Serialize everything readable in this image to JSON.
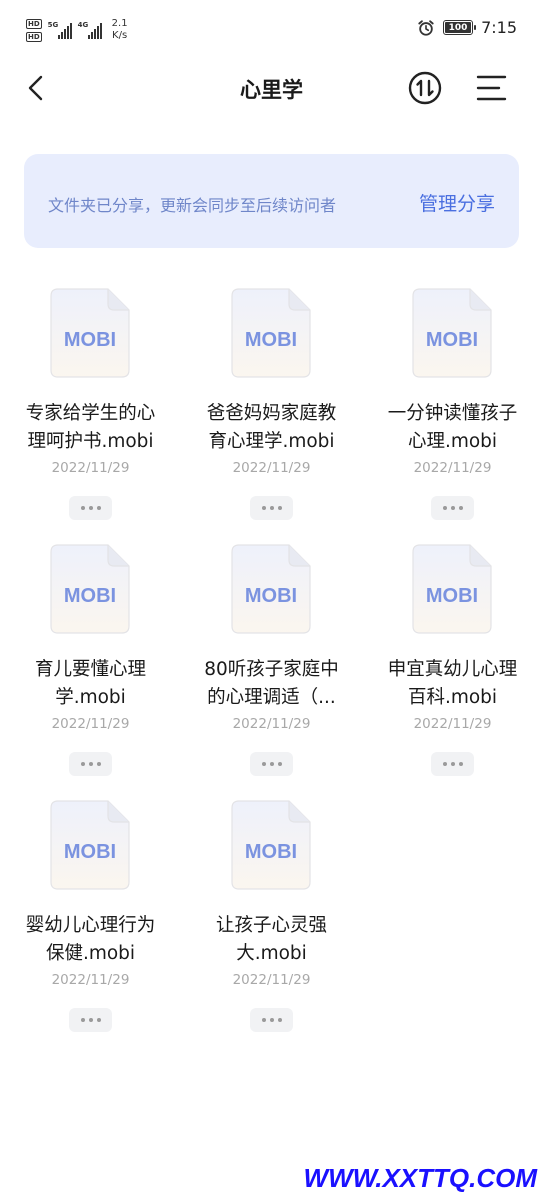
{
  "status_bar": {
    "sim1": "HD",
    "sim2": "HD",
    "net1": "5G",
    "net2": "4G",
    "speed_value": "2.1",
    "speed_unit": "K/s",
    "battery": "100",
    "time": "7:15"
  },
  "header": {
    "title": "心里学",
    "back_icon": "chevron-left-icon",
    "sort_icon": "sort-updown-icon",
    "menu_icon": "menu-lines-icon"
  },
  "banner": {
    "text": "文件夹已分享，更新会同步至后续访问者",
    "action": "管理分享"
  },
  "files": [
    {
      "icon_label": "MOBI",
      "name_line1": "专家给学生的心",
      "name_line2": "理呵护书.mobi",
      "date": "2022/11/29"
    },
    {
      "icon_label": "MOBI",
      "name_line1": "爸爸妈妈家庭教",
      "name_line2": "育心理学.mobi",
      "date": "2022/11/29"
    },
    {
      "icon_label": "MOBI",
      "name_line1": "一分钟读懂孩子",
      "name_line2": "心理.mobi",
      "date": "2022/11/29"
    },
    {
      "icon_label": "MOBI",
      "name_line1": "育儿要懂心理",
      "name_line2": "学.mobi",
      "date": "2022/11/29"
    },
    {
      "icon_label": "MOBI",
      "name_line1": "80听孩子家庭中",
      "name_line2": "的心理调适（...",
      "date": "2022/11/29"
    },
    {
      "icon_label": "MOBI",
      "name_line1": "申宜真幼儿心理",
      "name_line2": "百科.mobi",
      "date": "2022/11/29"
    },
    {
      "icon_label": "MOBI",
      "name_line1": "婴幼儿心理行为",
      "name_line2": "保健.mobi",
      "date": "2022/11/29"
    },
    {
      "icon_label": "MOBI",
      "name_line1": "让孩子心灵强",
      "name_line2": "大.mobi",
      "date": "2022/11/29"
    }
  ],
  "colors": {
    "accent": "#4a6fe0",
    "banner_bg": "#e8edfd",
    "banner_text": "#6f86c9",
    "mobi_label": "#7b93e0",
    "date": "#a8a8a8"
  },
  "watermark": "WWW.XXTTQ.COM"
}
